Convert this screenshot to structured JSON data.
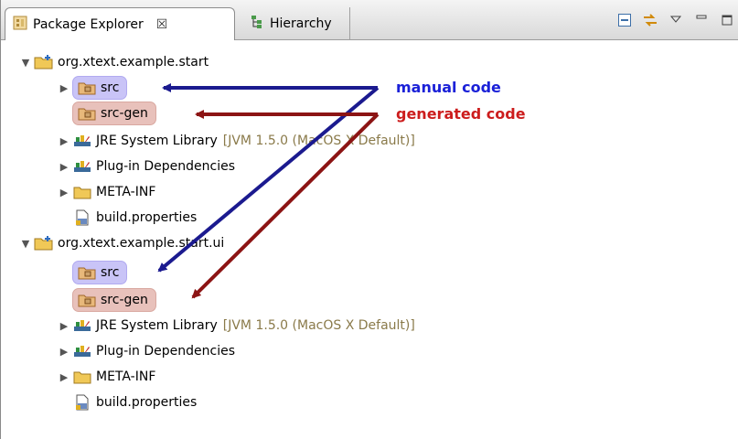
{
  "tabs": [
    {
      "label": "Package Explorer",
      "close": "☒",
      "active": true
    },
    {
      "label": "Hierarchy",
      "active": false
    }
  ],
  "projects": [
    {
      "name": "org.xtext.example.start",
      "items": [
        {
          "label": "src",
          "kind": "source-folder",
          "highlight": "blue"
        },
        {
          "label": "src-gen",
          "kind": "source-folder",
          "highlight": "red"
        },
        {
          "label": "JRE System Library",
          "decoration": "[JVM 1.5.0 (MacOS X Default)]",
          "kind": "library"
        },
        {
          "label": "Plug-in Dependencies",
          "kind": "library"
        },
        {
          "label": "META-INF",
          "kind": "folder"
        },
        {
          "label": "build.properties",
          "kind": "file"
        }
      ]
    },
    {
      "name": "org.xtext.example.start.ui",
      "items": [
        {
          "label": "src",
          "kind": "source-folder",
          "highlight": "blue"
        },
        {
          "label": "src-gen",
          "kind": "source-folder",
          "highlight": "red"
        },
        {
          "label": "JRE System Library",
          "decoration": "[JVM 1.5.0 (MacOS X Default)]",
          "kind": "library"
        },
        {
          "label": "Plug-in Dependencies",
          "kind": "library"
        },
        {
          "label": "META-INF",
          "kind": "folder"
        },
        {
          "label": "build.properties",
          "kind": "file"
        }
      ]
    }
  ],
  "annotations": {
    "manual": "manual code",
    "generated": "generated code"
  },
  "colors": {
    "blue_arrow": "#1b1a8f",
    "red_arrow": "#8c1414",
    "blue_highlight": "#c9c4f7",
    "red_highlight": "#e8c1bb"
  },
  "toolbar_icons": [
    "collapse-all-icon",
    "link-with-editor-icon",
    "view-menu-icon",
    "minimize-icon",
    "maximize-icon"
  ]
}
